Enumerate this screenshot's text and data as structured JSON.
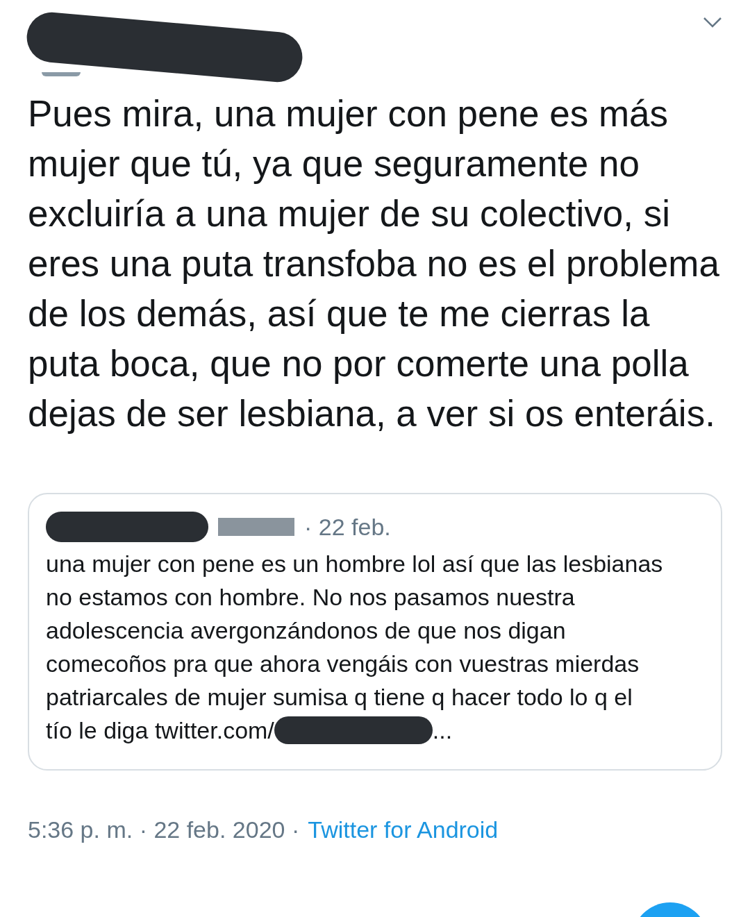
{
  "tweet": {
    "text": "Pues mira, una mujer con pene es más mujer que tú, ya que seguramente no excluiría a una mujer de su colectivo, si eres una puta transfoba no es el problema de los demás, así que te me cierras la puta boca, que no por comerte una polla dejas de ser lesbiana, a ver si os enteráis.",
    "quoted": {
      "date": "· 22 feb.",
      "lines": [
        "una mujer con pene es un hombre lol así que las lesbianas",
        "no estamos con hombre. No nos pasamos nuestra",
        "adolescencia avergonzándonos de que nos digan",
        "comecoños pra que ahora vengáis con vuestras mierdas",
        "patriarcales de mujer sumisa q tiene q hacer todo lo q el",
        "tío le diga twitter.com/"
      ],
      "ellipsis": "..."
    },
    "timestamp": "5:36 p. m. · 22 feb. 2020 ·",
    "source": "Twitter for Android"
  }
}
